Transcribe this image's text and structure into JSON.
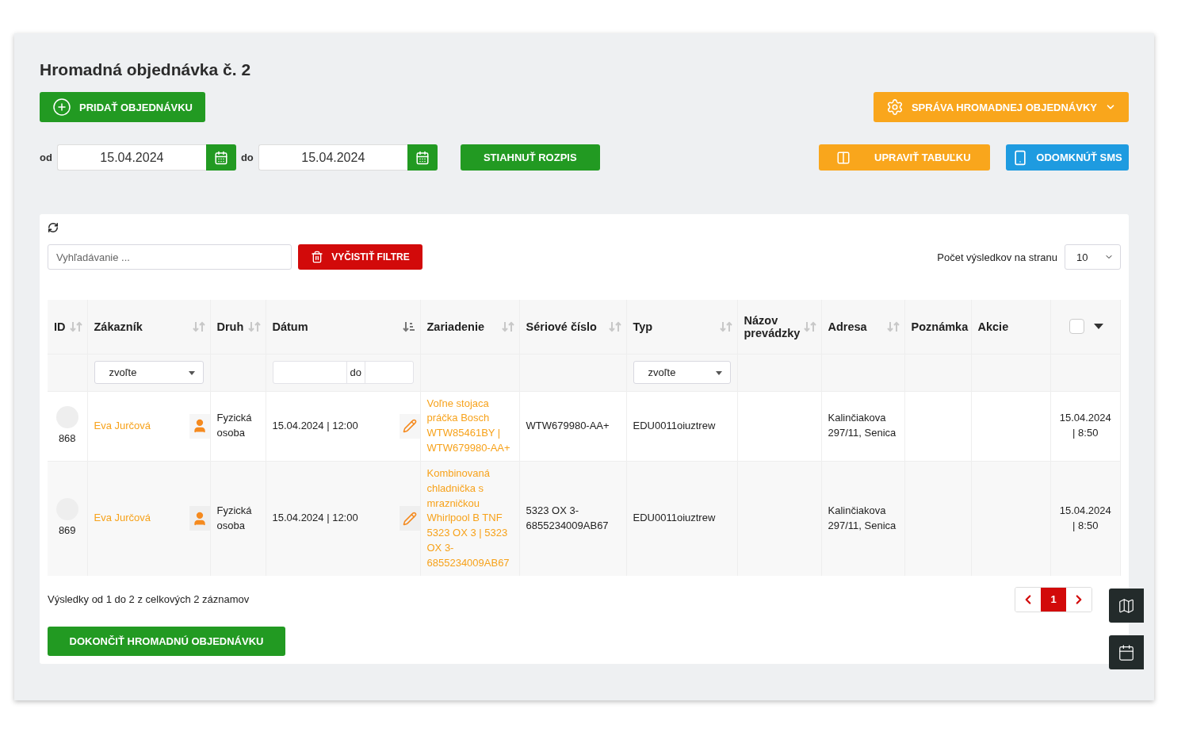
{
  "title": "Hromadná objednávka č. 2",
  "add_button": "PRIDAŤ OBJEDNÁVKU",
  "manage_button": "SPRÁVA HROMADNEJ OBJEDNÁVKY",
  "date_from": {
    "label": "od",
    "value": "15.04.2024"
  },
  "date_to": {
    "label": "do",
    "value": "15.04.2024"
  },
  "download_button": "STIAHNUŤ ROZPIS",
  "edit_table_button": "UPRAVIŤ TABUĽKU",
  "sms_button": "ODOMKNÚŤ SMS",
  "search": {
    "placeholder": "Vyhľadávanie ..."
  },
  "clear_filters_button": "VYČISTIŤ FILTRE",
  "page_size": {
    "label": "Počet výsledkov na stranu",
    "value": "10"
  },
  "columns": [
    {
      "label": "ID",
      "sorted": false
    },
    {
      "label": "Zákazník",
      "sorted": false,
      "filter": {
        "kind": "select",
        "value": "zvoľte"
      }
    },
    {
      "label": "Druh",
      "sorted": false
    },
    {
      "label": "Dátum",
      "sorted": true,
      "filter": {
        "kind": "range",
        "separator": "do"
      }
    },
    {
      "label": "Zariadenie",
      "sorted": false
    },
    {
      "label": "Sériové číslo",
      "sorted": false
    },
    {
      "label": "Typ",
      "sorted": false,
      "filter": {
        "kind": "select",
        "value": "zvoľte"
      }
    },
    {
      "label": "Názov prevádzky",
      "sorted": false
    },
    {
      "label": "Adresa",
      "sorted": false
    },
    {
      "label": "Poznámka"
    },
    {
      "label": "Akcie"
    }
  ],
  "select_all": {
    "checked": false
  },
  "rows": [
    {
      "id": "868",
      "customer": "Eva Jurčová",
      "kind": "Fyzická osoba",
      "date": "15.04.2024 | 12:00",
      "device": "Voľne stojaca práčka Bosch WTW85461BY | WTW679980-AA+",
      "serial": "WTW679980-AA+",
      "type": "EDU0011oiuztrew",
      "address": "Kalinčiakova 297/11, Senica",
      "created": "15.04.2024 | 8:50"
    },
    {
      "id": "869",
      "customer": "Eva Jurčová",
      "kind": "Fyzická osoba",
      "date": "15.04.2024 | 12:00",
      "device": "Kombinovaná chladnička s mrazničkou Whirlpool B TNF 5323 OX 3 | 5323 OX 3-6855234009AB67",
      "serial": "5323 OX 3-6855234009AB67",
      "type": "EDU0011oiuztrew",
      "address": "Kalinčiakova 297/11, Senica",
      "created": "15.04.2024 | 8:50"
    }
  ],
  "results_text": "Výsledky od 1 do 2 z celkových 2 záznamov",
  "pages": [
    {
      "label": "1",
      "selected": true
    }
  ],
  "finish_button": "DOKONČIŤ HROMADNÚ OBJEDNÁVKU"
}
